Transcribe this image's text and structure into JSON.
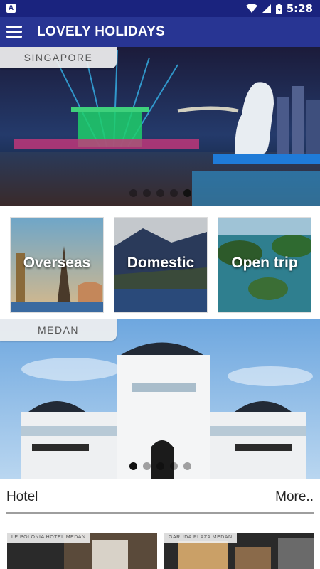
{
  "status_bar": {
    "time": "5:28",
    "notification_icon": "A"
  },
  "app_bar": {
    "title": "LOVELY HOLIDAYS",
    "menu_icon": "hamburger-icon"
  },
  "carousel_top": {
    "tag": "SINGAPORE",
    "dot_count": 5,
    "active_index": 4
  },
  "categories": [
    {
      "label": "Overseas"
    },
    {
      "label": "Domestic"
    },
    {
      "label": "Open trip"
    }
  ],
  "carousel_second": {
    "tag": "MEDAN",
    "dot_count": 5,
    "active_index": 0
  },
  "hotel_section": {
    "title": "Hotel",
    "more_label": "More..",
    "items": [
      {
        "name": "LE POLONIA HOTEL MEDAN"
      },
      {
        "name": "GARUDA PLAZA MEDAN"
      }
    ]
  },
  "colors": {
    "status_bar": "#1a237e",
    "app_bar": "#283593"
  }
}
